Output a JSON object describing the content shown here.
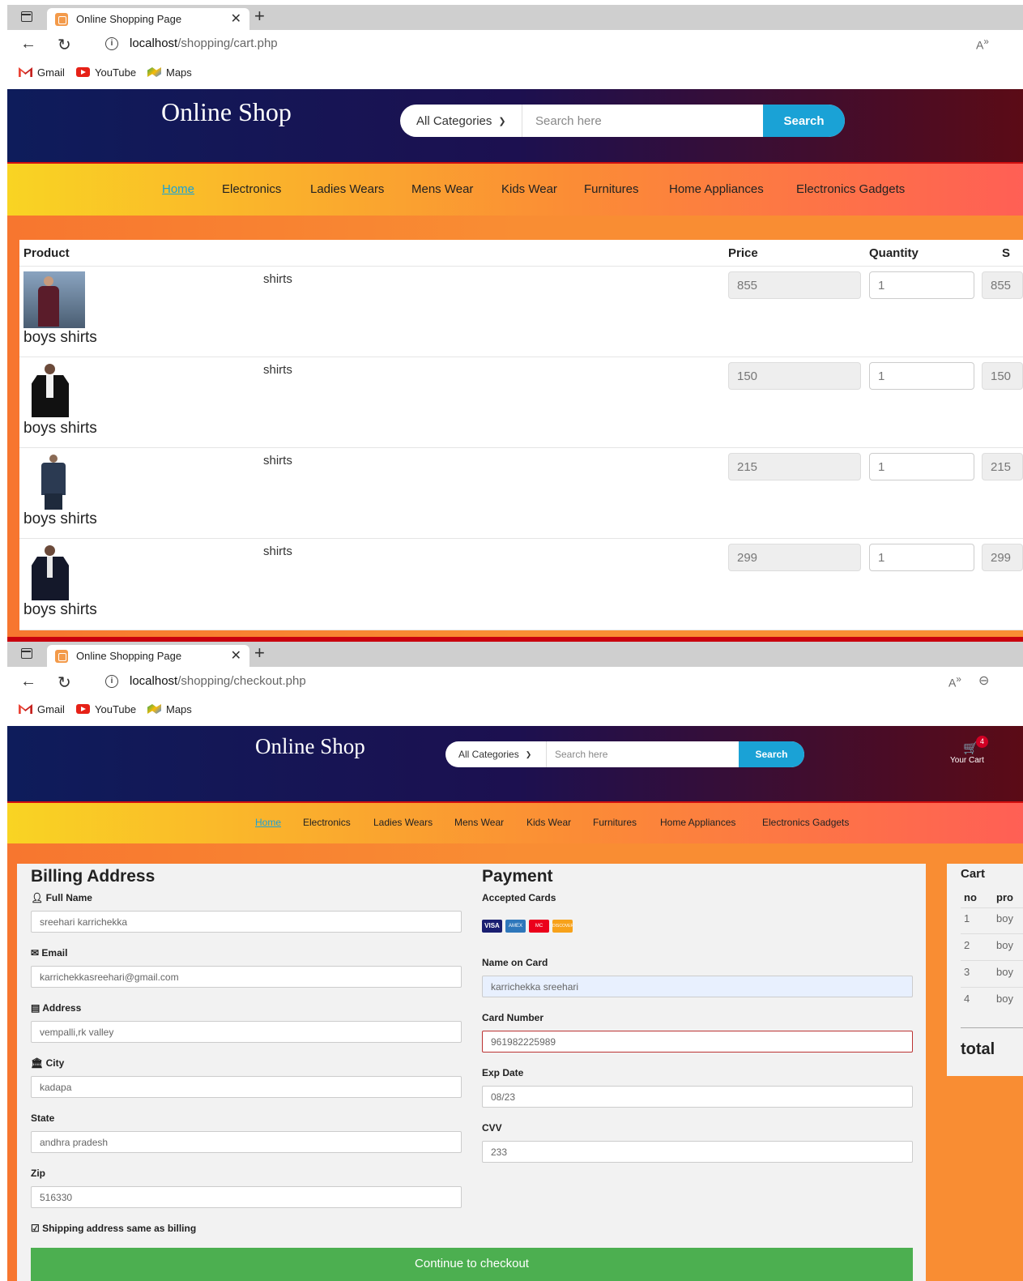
{
  "window1": {
    "tab_title": "Online Shopping Page",
    "url_host": "localhost",
    "url_path": "/shopping/cart.php"
  },
  "window2": {
    "tab_title": "Online Shopping Page",
    "url_host": "localhost",
    "url_path": "/shopping/checkout.php"
  },
  "bookmarks": [
    "Gmail",
    "YouTube",
    "Maps"
  ],
  "shop": {
    "logo": "Online Shop",
    "category": "All Categories",
    "search_placeholder": "Search here",
    "search_button": "Search",
    "cart_label": "Your Cart",
    "cart_count": "4"
  },
  "menu": [
    "Home",
    "Electronics",
    "Ladies Wears",
    "Mens Wear",
    "Kids Wear",
    "Furnitures",
    "Home Appliances",
    "Electronics Gadgets"
  ],
  "cart": {
    "headers": [
      "Product",
      "Price",
      "Quantity",
      "S"
    ],
    "rows": [
      {
        "name": "boys shirts",
        "category": "shirts",
        "price": "855",
        "qty": "1",
        "subtotal": "855"
      },
      {
        "name": "boys shirts",
        "category": "shirts",
        "price": "150",
        "qty": "1",
        "subtotal": "150"
      },
      {
        "name": "boys shirts",
        "category": "shirts",
        "price": "215",
        "qty": "1",
        "subtotal": "215"
      },
      {
        "name": "boys shirts",
        "category": "shirts",
        "price": "299",
        "qty": "1",
        "subtotal": "299"
      }
    ]
  },
  "checkout": {
    "billing_title": "Billing Address",
    "full_name_label": "Full Name",
    "full_name": "sreehari karrichekka",
    "email_label": "Email",
    "email": "karrichekkasreehari@gmail.com",
    "address_label": "Address",
    "address": "vempalli,rk valley",
    "city_label": "City",
    "city": "kadapa",
    "state_label": "State",
    "state": "andhra pradesh",
    "zip_label": "Zip",
    "zip": "516330",
    "same_address_label": "Shipping address same as billing",
    "payment_title": "Payment",
    "accepted_cards_label": "Accepted Cards",
    "cards": [
      "VISA",
      "AMEX",
      "MC",
      "DISCOVER"
    ],
    "name_on_card_label": "Name on Card",
    "name_on_card": "karrichekka sreehari",
    "card_number_label": "Card Number",
    "card_number": "961982225989",
    "exp_label": "Exp Date",
    "exp": "08/23",
    "cvv_label": "CVV",
    "cvv": "233",
    "submit": "Continue to checkout"
  },
  "side_cart": {
    "title": "Cart",
    "col_no": "no",
    "col_pr": "pro",
    "rows": [
      {
        "no": "1",
        "pr": "boy"
      },
      {
        "no": "2",
        "pr": "boy"
      },
      {
        "no": "3",
        "pr": "boy"
      },
      {
        "no": "4",
        "pr": "boy"
      }
    ],
    "total_label": "total"
  },
  "colors": {
    "header_start": "#0e1c5b",
    "header_end": "#5b0b16",
    "search_button": "#1aa2d6",
    "checkout_button": "#4caf50",
    "separator": "#c8000e"
  }
}
